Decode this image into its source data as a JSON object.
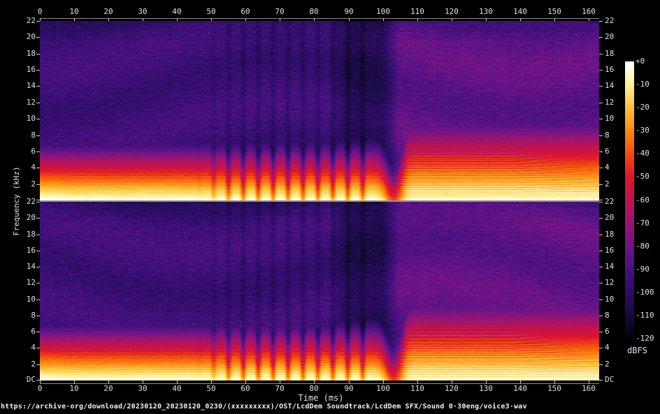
{
  "app": {
    "view": "dual-channel audio spectrogram"
  },
  "time_axis": {
    "label": "Time (ms)",
    "ticks": [
      {
        "value": 0,
        "label": "0"
      },
      {
        "value": 10,
        "label": "10"
      },
      {
        "value": 20,
        "label": "20"
      },
      {
        "value": 30,
        "label": "30"
      },
      {
        "value": 40,
        "label": "40"
      },
      {
        "value": 50,
        "label": "50"
      },
      {
        "value": 60,
        "label": "60"
      },
      {
        "value": 70,
        "label": "70"
      },
      {
        "value": 80,
        "label": "80"
      },
      {
        "value": 90,
        "label": "90"
      },
      {
        "value": 100,
        "label": "100"
      },
      {
        "value": 110,
        "label": "110"
      },
      {
        "value": 120,
        "label": "120"
      },
      {
        "value": 130,
        "label": "130"
      },
      {
        "value": 140,
        "label": "140"
      },
      {
        "value": 150,
        "label": "150"
      },
      {
        "value": 160,
        "label": "160"
      }
    ],
    "range_ms": [
      0,
      163
    ]
  },
  "freq_axis": {
    "label": "Frequency (kHz)",
    "ticks": [
      {
        "value": 22,
        "label": "22"
      },
      {
        "value": 20,
        "label": "20"
      },
      {
        "value": 18,
        "label": "18"
      },
      {
        "value": 16,
        "label": "16"
      },
      {
        "value": 14,
        "label": "14"
      },
      {
        "value": 12,
        "label": "12"
      },
      {
        "value": 10,
        "label": "10"
      },
      {
        "value": 8,
        "label": "8"
      },
      {
        "value": 6,
        "label": "6"
      },
      {
        "value": 4,
        "label": "4"
      },
      {
        "value": 2,
        "label": "2"
      }
    ],
    "dc_label": "DC",
    "range_khz": [
      0,
      22
    ]
  },
  "colorbar": {
    "unit_label": "dBFS",
    "ticks": [
      {
        "value": 0,
        "label": "+0"
      },
      {
        "value": -10,
        "label": "-10"
      },
      {
        "value": -20,
        "label": "-20"
      },
      {
        "value": -30,
        "label": "-30"
      },
      {
        "value": -40,
        "label": "-40"
      },
      {
        "value": -50,
        "label": "-50"
      },
      {
        "value": -60,
        "label": "-60"
      },
      {
        "value": -70,
        "label": "-70"
      },
      {
        "value": -80,
        "label": "-80"
      },
      {
        "value": -90,
        "label": "-90"
      },
      {
        "value": -100,
        "label": "-100"
      },
      {
        "value": -110,
        "label": "-110"
      },
      {
        "value": -120,
        "label": "-120"
      }
    ],
    "palette": [
      {
        "db": 0,
        "color": "#ffffff"
      },
      {
        "db": -10,
        "color": "#fff299"
      },
      {
        "db": -20,
        "color": "#fdc138"
      },
      {
        "db": -30,
        "color": "#fb8a0d"
      },
      {
        "db": -40,
        "color": "#f34b10"
      },
      {
        "db": -50,
        "color": "#dd142e"
      },
      {
        "db": -60,
        "color": "#c01350"
      },
      {
        "db": -70,
        "color": "#981571"
      },
      {
        "db": -80,
        "color": "#6d1487"
      },
      {
        "db": -90,
        "color": "#44117f"
      },
      {
        "db": -100,
        "color": "#2a0d62"
      },
      {
        "db": -110,
        "color": "#150b3a"
      },
      {
        "db": -120,
        "color": "#020107"
      }
    ]
  },
  "footer": {
    "url": "https://archive·org/download/20230120_20230120_0230/(xxxxxxxxx)/OST/LcdDem Soundtrack/LcdDem SFX/Sound 0·30eng/voice3·wav"
  },
  "chart_data": {
    "type": "heatmap",
    "subtype": "spectrogram",
    "channels": 2,
    "x": {
      "label": "Time (ms)",
      "min": 0,
      "max": 163,
      "tick_step": 10
    },
    "y": {
      "label": "Frequency (kHz)",
      "min": 0,
      "max": 22,
      "tick_step": 2,
      "dc_label": "DC"
    },
    "z": {
      "label": "dBFS",
      "min": -120,
      "max": 0
    },
    "legend_position": "right-colorbar",
    "grid": false,
    "features": {
      "low_band": {
        "freq_range_khz": [
          0,
          2.5
        ],
        "peak_level_dbfs": -5,
        "present_ms": [
          0,
          163
        ]
      },
      "pulse_train": {
        "time_range_ms": [
          44,
          97
        ],
        "period_ms": 4.35,
        "dip_db": 24
      },
      "silence_gap": {
        "time_range_ms": [
          96,
          105
        ],
        "band_gap_center_ms": 103
      },
      "voiced_segment": {
        "time_range_ms": [
          105,
          163
        ],
        "harmonic_spacing_khz": 0.215,
        "harmonics_visible_up_to_khz": 8.5
      },
      "noise_floor_dbfs": {
        "before_gap": -93,
        "in_gap": -104,
        "after_gap": -84
      }
    },
    "render": {
      "seeds": [
        11,
        97
      ]
    }
  }
}
